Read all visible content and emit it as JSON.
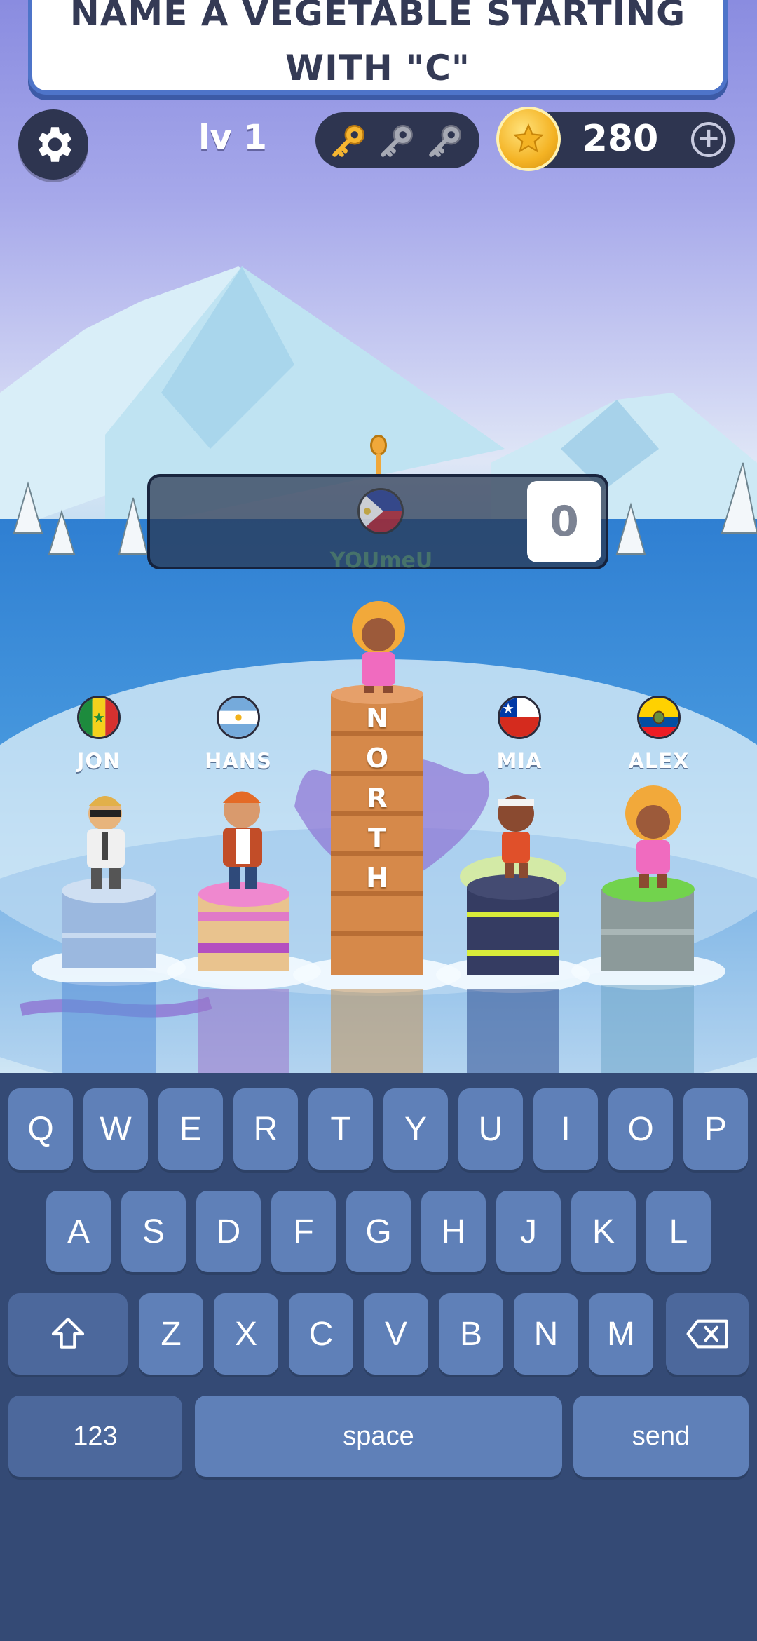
{
  "question": {
    "line1": "NAME A VEGETABLE STARTING",
    "line2": "WITH \"C\""
  },
  "hud": {
    "level": "lv 1",
    "keys_collected": 1,
    "keys_total": 3,
    "coins": "280",
    "add_coins": "+"
  },
  "current_player": {
    "name": "YOUmeU",
    "flag": "philippines-flag",
    "score": "0"
  },
  "players": [
    {
      "name": "JON",
      "flag": "senegal-flag"
    },
    {
      "name": "HANS",
      "flag": "argentina-flag"
    },
    {
      "name": "MIA",
      "flag": "chile-flag"
    },
    {
      "name": "ALEX",
      "flag": "ecuador-flag"
    }
  ],
  "tower_word": [
    "N",
    "O",
    "R",
    "T",
    "H"
  ],
  "keyboard": {
    "row1": [
      "Q",
      "W",
      "E",
      "R",
      "T",
      "Y",
      "U",
      "I",
      "O",
      "P"
    ],
    "row2": [
      "A",
      "S",
      "D",
      "F",
      "G",
      "H",
      "J",
      "K",
      "L"
    ],
    "row3": [
      "Z",
      "X",
      "C",
      "V",
      "B",
      "N",
      "M"
    ],
    "numbers": "123",
    "space": "space",
    "send": "send",
    "shift_icon": "shift-icon",
    "backspace_icon": "backspace-icon"
  },
  "colors": {
    "banner_border": "#4e74c9",
    "hud_pill": "#2e3550",
    "keyboard_bg": "#344a75",
    "key_bg": "#5f80b8"
  }
}
